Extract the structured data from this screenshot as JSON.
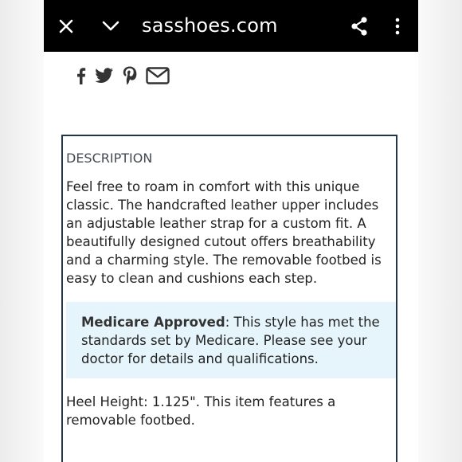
{
  "browser": {
    "url": "sasshoes.com",
    "close_icon": "close-icon",
    "chevron_icon": "chevron-down-icon",
    "share_icon": "share-icon",
    "more_icon": "more-vertical-icon"
  },
  "social": {
    "icons": [
      "facebook-icon",
      "twitter-icon",
      "pinterest-icon",
      "email-icon"
    ]
  },
  "description": {
    "title": "DESCRIPTION",
    "body": "Feel free to roam in comfort with this unique classic. The handcrafted leather upper includes an adjustable leather strap for a custom fit. A beautifully designed cutout offers breathability and a charming style. The removable footbed is easy to clean and cushions each step.",
    "medicare_label": "Medicare Approved",
    "medicare_text": ": This style has met the standards set by Medicare. Please see your doctor for details and qualifications.",
    "heel_text": "Heel Height: 1.125\". This item features a removable footbed."
  },
  "colors": {
    "topbar": "#000000",
    "box_border": "#243447",
    "medicare_bg": "#e6f5fb"
  }
}
